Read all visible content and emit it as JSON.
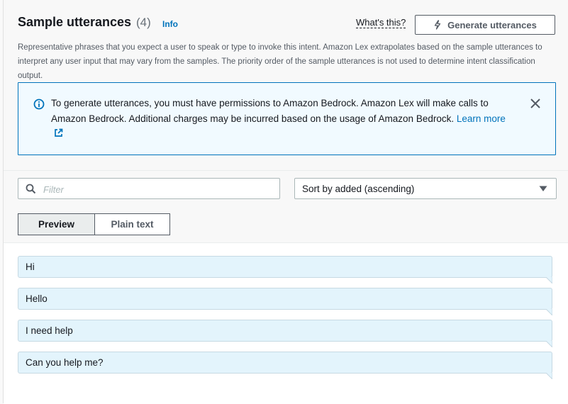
{
  "header": {
    "title": "Sample utterances",
    "count": "(4)",
    "info_label": "Info",
    "whats_this": "What's this?",
    "generate_label": "Generate utterances"
  },
  "description": "Representative phrases that you expect a user to speak or type to invoke this intent. Amazon Lex extrapolates based on the sample utterances to interpret any user input that may vary from the samples. The priority order of the sample utterances is not used to determine intent classification output.",
  "alert": {
    "message": "To generate utterances, you must have permissions to Amazon Bedrock. Amazon Lex will make calls to Amazon Bedrock. Additional charges may be incurred based on the usage of Amazon Bedrock.",
    "link_label": "Learn more"
  },
  "filter": {
    "placeholder": "Filter"
  },
  "sort": {
    "selected": "Sort by added (ascending)"
  },
  "view_toggle": {
    "preview_label": "Preview",
    "plain_label": "Plain text",
    "active": "Preview"
  },
  "utterances": [
    "Hi",
    "Hello",
    "I need help",
    "Can you help me?"
  ],
  "icons": {
    "generate": "lightning-icon",
    "alert": "info-icon",
    "external": "external-link-icon",
    "close": "close-icon",
    "search": "search-icon",
    "dropdown": "caret-down-icon"
  },
  "colors": {
    "link": "#0073bb",
    "alert_bg": "#f1faff",
    "utterance_bg": "#e3f4fc"
  }
}
